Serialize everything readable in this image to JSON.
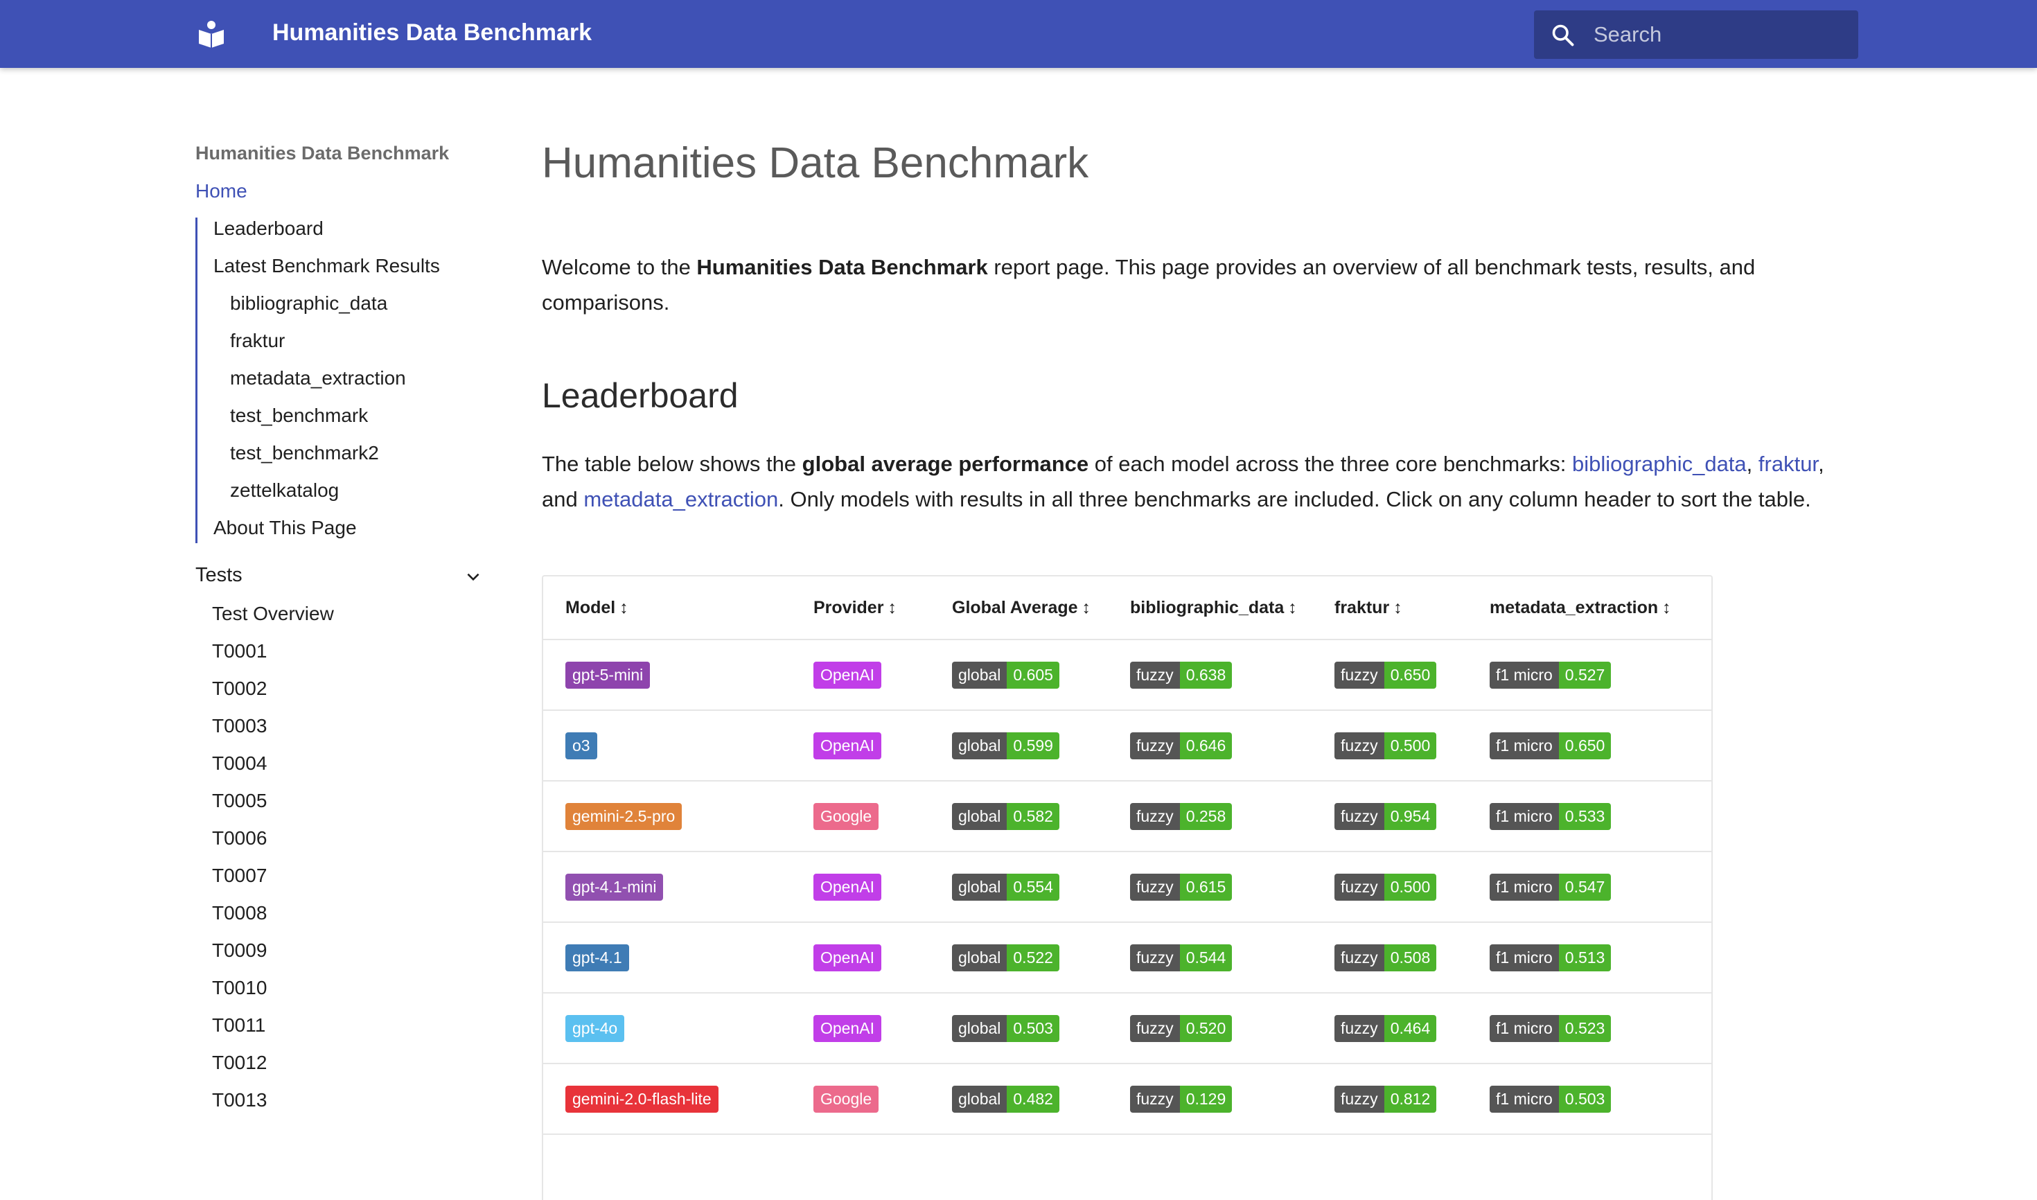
{
  "header": {
    "title": "Humanities Data Benchmark",
    "search_placeholder": "Search"
  },
  "sidebar": {
    "heading": "Humanities Data Benchmark",
    "home": "Home",
    "items": [
      "Leaderboard",
      "Latest Benchmark Results"
    ],
    "benchmarks": [
      "bibliographic_data",
      "fraktur",
      "metadata_extraction",
      "test_benchmark",
      "test_benchmark2",
      "zettelkatalog"
    ],
    "about": "About This Page",
    "tests_section": "Tests",
    "tests": [
      "Test Overview",
      "T0001",
      "T0002",
      "T0003",
      "T0004",
      "T0005",
      "T0006",
      "T0007",
      "T0008",
      "T0009",
      "T0010",
      "T0011",
      "T0012",
      "T0013"
    ]
  },
  "main": {
    "title": "Humanities Data Benchmark",
    "intro_pre": "Welcome to the ",
    "intro_bold": "Humanities Data Benchmark",
    "intro_post": " report page. This page provides an overview of all benchmark tests, results, and comparisons.",
    "leaderboard_title": "Leaderboard",
    "lb_pre": "The table below shows the ",
    "lb_bold": "global average performance",
    "lb_mid": " of each model across the three core benchmarks: ",
    "lb_link1": "bibliographic_data",
    "lb_sep1": ", ",
    "lb_link2": "fraktur",
    "lb_sep2": ", and ",
    "lb_link3": "metadata_extraction",
    "lb_post": ". Only models with results in all three benchmarks are included. Click on any column header to sort the table."
  },
  "table": {
    "sort_glyph": "↕",
    "columns": [
      "Model",
      "Provider",
      "Global Average",
      "bibliographic_data",
      "fraktur",
      "metadata_extraction"
    ],
    "labels": {
      "global": "global",
      "fuzzy": "fuzzy",
      "f1": "f1 micro"
    },
    "rows": [
      {
        "model": "gpt-5-mini",
        "model_color": "#8e44ad",
        "provider": "OpenAI",
        "provider_color": "#c13ee8",
        "global": "0.605",
        "bib": "0.638",
        "fraktur": "0.650",
        "meta": "0.527"
      },
      {
        "model": "o3",
        "model_color": "#3f7cb5",
        "provider": "OpenAI",
        "provider_color": "#c13ee8",
        "global": "0.599",
        "bib": "0.646",
        "fraktur": "0.500",
        "meta": "0.650"
      },
      {
        "model": "gemini-2.5-pro",
        "model_color": "#e0833a",
        "provider": "Google",
        "provider_color": "#ec6a8c",
        "global": "0.582",
        "bib": "0.258",
        "fraktur": "0.954",
        "meta": "0.533"
      },
      {
        "model": "gpt-4.1-mini",
        "model_color": "#9150b0",
        "provider": "OpenAI",
        "provider_color": "#c13ee8",
        "global": "0.554",
        "bib": "0.615",
        "fraktur": "0.500",
        "meta": "0.547"
      },
      {
        "model": "gpt-4.1",
        "model_color": "#3f7cb5",
        "provider": "OpenAI",
        "provider_color": "#c13ee8",
        "global": "0.522",
        "bib": "0.544",
        "fraktur": "0.508",
        "meta": "0.513"
      },
      {
        "model": "gpt-4o",
        "model_color": "#5bc0f0",
        "provider": "OpenAI",
        "provider_color": "#c13ee8",
        "global": "0.503",
        "bib": "0.520",
        "fraktur": "0.464",
        "meta": "0.523"
      },
      {
        "model": "gemini-2.0-flash-lite",
        "model_color": "#e8333a",
        "provider": "Google",
        "provider_color": "#ec6a8c",
        "global": "0.482",
        "bib": "0.129",
        "fraktur": "0.812",
        "meta": "0.503"
      }
    ]
  },
  "colors": {
    "primary": "#3f51b5",
    "badge_label": "#555555",
    "badge_value": "#4cb32c"
  }
}
